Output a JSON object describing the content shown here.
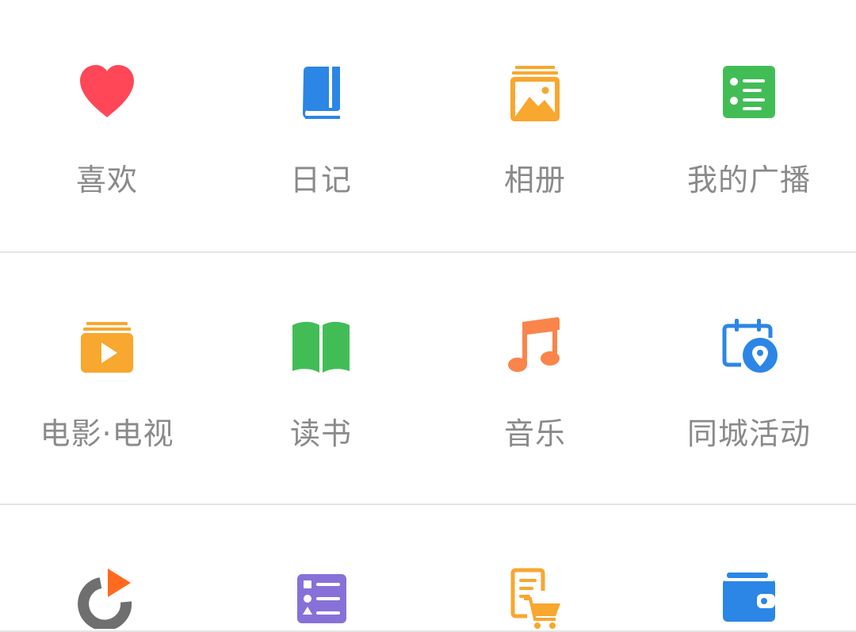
{
  "menu": {
    "rows": [
      [
        {
          "label": "喜欢",
          "icon": "heart-icon",
          "color": "#ff4757"
        },
        {
          "label": "日记",
          "icon": "diary-book-icon",
          "color": "#2b86e6"
        },
        {
          "label": "相册",
          "icon": "photo-album-icon",
          "color": "#f8a72f"
        },
        {
          "label": "我的广播",
          "icon": "broadcast-list-icon",
          "color": "#42bd56"
        }
      ],
      [
        {
          "label": "电影·电视",
          "icon": "movie-tv-icon",
          "color": "#f8a72f"
        },
        {
          "label": "读书",
          "icon": "open-book-icon",
          "color": "#42bd56"
        },
        {
          "label": "音乐",
          "icon": "music-note-icon",
          "color": "#f9854b"
        },
        {
          "label": "同城活动",
          "icon": "calendar-location-icon",
          "color": "#2b86e6"
        }
      ],
      [
        {
          "icon": "play-ring-icon",
          "color": "#ff6a1e"
        },
        {
          "icon": "checklist-icon",
          "color": "#8771d8"
        },
        {
          "icon": "order-cart-icon",
          "color": "#f8a72f"
        },
        {
          "icon": "wallet-icon",
          "color": "#2b86e6"
        }
      ]
    ]
  }
}
